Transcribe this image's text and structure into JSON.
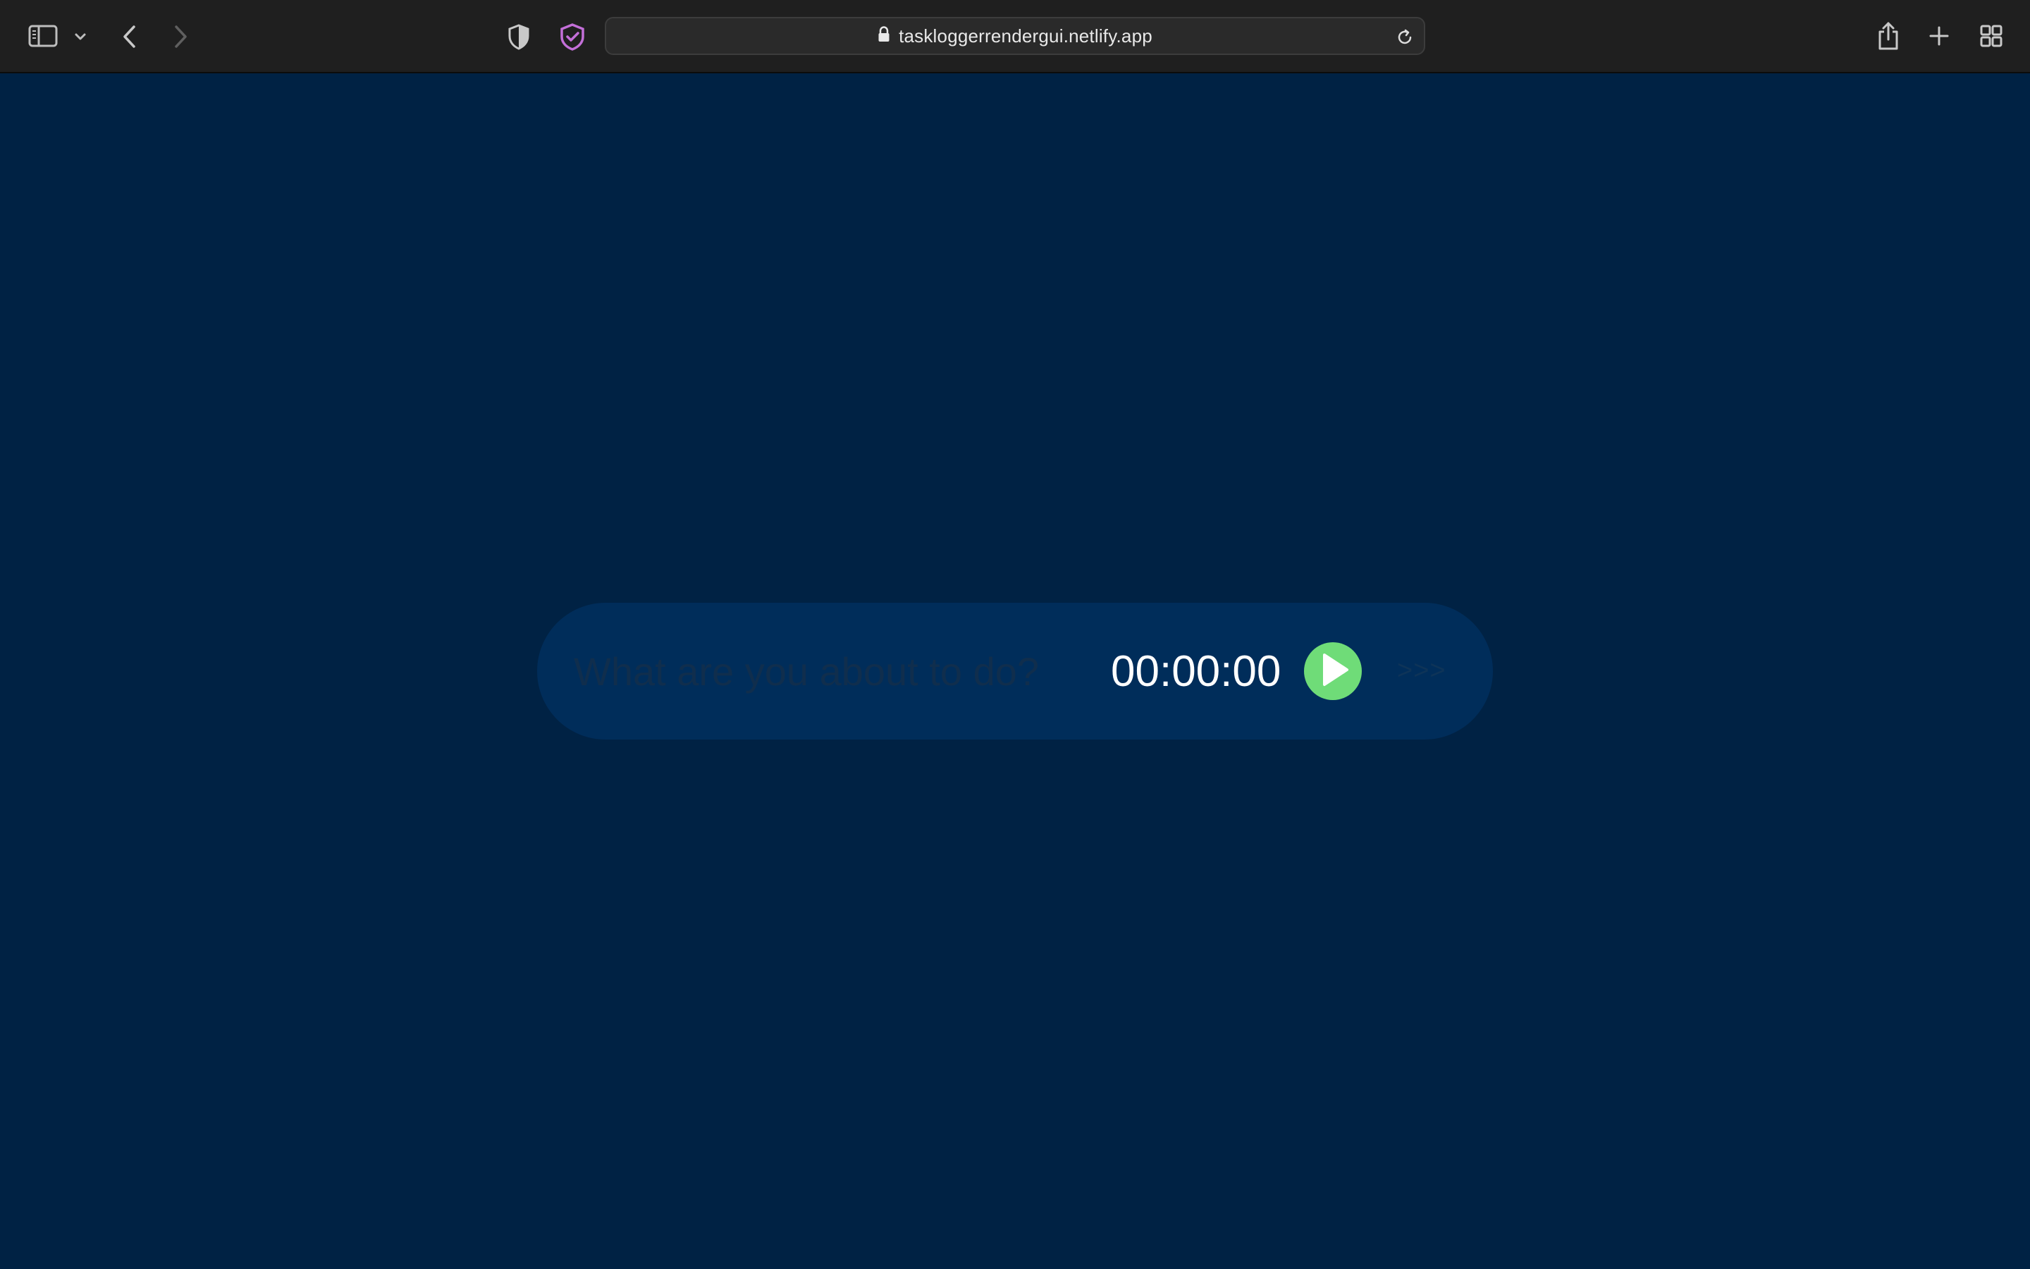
{
  "browser": {
    "url": "taskloggerrendergui.netlify.app",
    "icons": {
      "sidebar": "sidebar-icon",
      "sidebar_menu": "chevron-down-icon",
      "back": "chevron-left-icon",
      "forward": "chevron-right-icon",
      "privacy": "shield-half-icon",
      "extension": "shield-check-icon",
      "lock": "lock-icon",
      "reload": "reload-icon",
      "share": "share-icon",
      "new_tab": "plus-icon",
      "tab_overview": "grid-icon"
    },
    "colors": {
      "toolbar": "#1f1f1f",
      "extension_accent": "#c36fd8"
    }
  },
  "task_logger": {
    "input_placeholder": "What are you about to do?",
    "input_value": "",
    "timer": "00:00:00",
    "play_icon": "play-icon",
    "next_label": ">>>",
    "colors": {
      "background": "#002244",
      "bar": "#002d5a",
      "play": "#6fdc78",
      "timer_text": "#ffffff"
    }
  }
}
